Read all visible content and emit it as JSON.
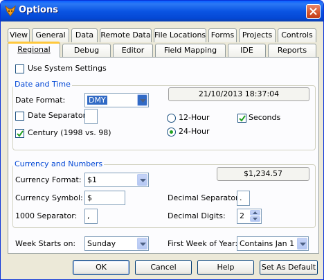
{
  "window": {
    "title": "Options"
  },
  "tabs_row1": [
    "View",
    "General",
    "Data",
    "Remote Data",
    "File Locations",
    "Forms",
    "Projects",
    "Controls"
  ],
  "tabs_row2": [
    "Regional",
    "Debug",
    "Editor",
    "Field Mapping",
    "IDE",
    "Reports"
  ],
  "active_tab": "Regional",
  "use_system_settings": {
    "label": "Use System Settings",
    "checked": false
  },
  "date_time": {
    "group_label": "Date and Time",
    "date_format_label": "Date Format:",
    "date_format_value": "DMY",
    "datetime_display": "21/10/2013 18:37:04",
    "date_separator_label": "Date Separator:",
    "date_separator_checked": false,
    "date_separator_value": "",
    "century_label": "Century (1998 vs. 98)",
    "century_checked": true,
    "hour12_label": "12-Hour",
    "hour24_label": "24-Hour",
    "selected_hour_mode": "24-Hour",
    "seconds_label": "Seconds",
    "seconds_checked": true
  },
  "currency_numbers": {
    "group_label": "Currency and Numbers",
    "currency_format_label": "Currency Format:",
    "currency_format_value": "$1",
    "currency_display": "$1,234.57",
    "currency_symbol_label": "Currency Symbol:",
    "currency_symbol_value": "$",
    "separator_1000_label": "1000 Separator:",
    "separator_1000_value": ",",
    "decimal_separator_label": "Decimal Separator:",
    "decimal_separator_value": ".",
    "decimal_digits_label": "Decimal Digits:",
    "decimal_digits_value": "2"
  },
  "week": {
    "week_starts_label": "Week Starts on:",
    "week_starts_value": "Sunday",
    "first_week_label": "First Week of Year:",
    "first_week_value": "Contains Jan 1"
  },
  "buttons": {
    "ok": "OK",
    "cancel": "Cancel",
    "help": "Help",
    "set_default": "Set As Default"
  },
  "colors": {
    "title_bar": "#0b55e3",
    "group_title": "#0046d5",
    "active_tab_highlight": "#ffc83c",
    "selection": "#316ac5"
  },
  "icons": {
    "app": "fox-icon",
    "close": "close-icon"
  }
}
